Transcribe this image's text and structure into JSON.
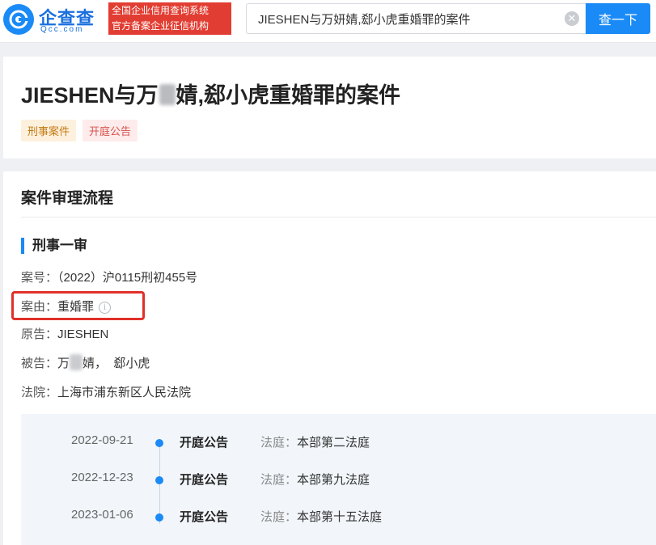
{
  "header": {
    "logo_text": "企查查",
    "logo_sub": "Qcc.com",
    "slogan_line1": "全国企业信用查询系统",
    "slogan_line2": "官方备案企业征信机构",
    "search_value": "JIESHEN与万妍婧,郄小虎重婚罪的案件",
    "search_button": "查一下"
  },
  "title_card": {
    "title_prefix": "JIESHEN与万",
    "title_suffix": "婧,郄小虎重婚罪的案件",
    "tags": [
      "刑事案件",
      "开庭公告"
    ]
  },
  "process": {
    "section_title": "案件审理流程",
    "stage_title": "刑事一审",
    "case_no_label": "案号：",
    "case_no": "（2022）沪0115刑初455号",
    "cause_label": "案由：",
    "cause": "重婚罪",
    "plaintiff_label": "原告：",
    "plaintiff": "JIESHEN",
    "defendant_label": "被告：",
    "defendant_prefix": "万",
    "defendant_suffix": "婧，",
    "defendant_2": "郄小虎",
    "court_label": "法院：",
    "court": "上海市浦东新区人民法院",
    "timeline": [
      {
        "date": "2022-09-21",
        "event": "开庭公告",
        "detail_label": "法庭：",
        "detail": "本部第二法庭"
      },
      {
        "date": "2022-12-23",
        "event": "开庭公告",
        "detail_label": "法庭：",
        "detail": "本部第九法庭"
      },
      {
        "date": "2023-01-06",
        "event": "开庭公告",
        "detail_label": "法庭：",
        "detail": "本部第十五法庭"
      }
    ]
  },
  "colors": {
    "brand_blue": "#1a8af6",
    "slogan_red": "#e23d32",
    "highlight_red": "#e0302a"
  }
}
